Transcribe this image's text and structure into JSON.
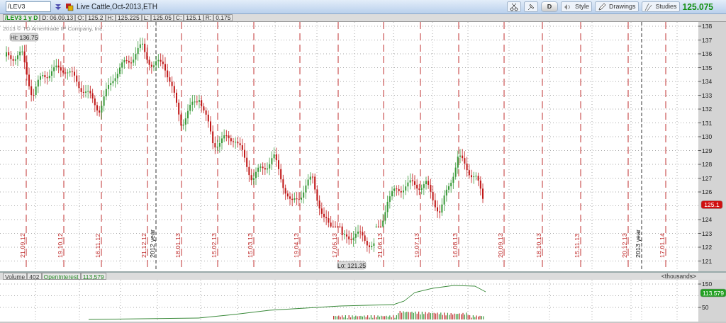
{
  "toolbar": {
    "symbol": "/LEV3",
    "description": "Live Cattle,Oct-2013,ETH",
    "aggregation_button": "D",
    "buttons": [
      "Style",
      "Drawings",
      "Studies"
    ],
    "last_price": "125.075"
  },
  "info_bar": {
    "title": "/LEV3 1 y D",
    "cells": [
      "D: 06.09.13",
      "O:",
      "125.2",
      "H:",
      "125.225",
      "L:",
      "125.05",
      "C:",
      "125.1",
      "R:",
      "0.175"
    ]
  },
  "price_chart": {
    "copyright": "2013 © TD Ameritrade IP Company, Inc.",
    "high_label": "Hi: 136.75",
    "low_label": "Lo: 121.25",
    "y_axis": [
      {
        "text": "138",
        "kind": "tick"
      },
      {
        "text": "137",
        "kind": "tick"
      },
      {
        "text": "136",
        "kind": "tick"
      },
      {
        "text": "135",
        "kind": "tick"
      },
      {
        "text": "134",
        "kind": "tick"
      },
      {
        "text": "133",
        "kind": "tick"
      },
      {
        "text": "132",
        "kind": "tick"
      },
      {
        "text": "131",
        "kind": "tick"
      },
      {
        "text": "130",
        "kind": "tick"
      },
      {
        "text": "129",
        "kind": "tick"
      },
      {
        "text": "128",
        "kind": "tick"
      },
      {
        "text": "127",
        "kind": "tick"
      },
      {
        "text": "126",
        "kind": "tick"
      },
      {
        "text": "125.1",
        "kind": "last"
      },
      {
        "text": "124",
        "kind": "tick"
      },
      {
        "text": "123",
        "kind": "tick"
      },
      {
        "text": "122",
        "kind": "tick"
      },
      {
        "text": "121",
        "kind": "tick"
      }
    ],
    "date_labels": [
      {
        "text": "21.09.12",
        "kind": "date"
      },
      {
        "text": "19.10.12",
        "kind": "date"
      },
      {
        "text": "16.11.12",
        "kind": "date"
      },
      {
        "text": "21.12.12",
        "kind": "date"
      },
      {
        "text": "2012 year",
        "kind": "year"
      },
      {
        "text": "18.01.13",
        "kind": "date"
      },
      {
        "text": "15.02.13",
        "kind": "date"
      },
      {
        "text": "15.03.13",
        "kind": "date"
      },
      {
        "text": "19.04.13",
        "kind": "date"
      },
      {
        "text": "17.05.13",
        "kind": "date"
      },
      {
        "text": "21.06.13",
        "kind": "date"
      },
      {
        "text": "19.07.13",
        "kind": "date"
      },
      {
        "text": "16.08.13",
        "kind": "date"
      },
      {
        "text": "20.09.13",
        "kind": "date"
      },
      {
        "text": "18.10.13",
        "kind": "date"
      },
      {
        "text": "15.11.13",
        "kind": "date"
      },
      {
        "text": "20.12.13",
        "kind": "date"
      },
      {
        "text": "2013 year",
        "kind": "year"
      },
      {
        "text": "17.01.14",
        "kind": "date"
      }
    ]
  },
  "study": {
    "cells": [
      {
        "text": "Volume",
        "kind": "label"
      },
      {
        "text": "402",
        "kind": "value"
      },
      {
        "text": "OpenInterest",
        "kind": "oi_label"
      },
      {
        "text": "113,579",
        "kind": "oi_value"
      }
    ],
    "units": "<thousands>",
    "y_axis": [
      {
        "text": "150",
        "kind": "tick"
      },
      {
        "text": "113.579",
        "kind": "last"
      },
      {
        "text": "50",
        "kind": "tick"
      }
    ]
  }
}
